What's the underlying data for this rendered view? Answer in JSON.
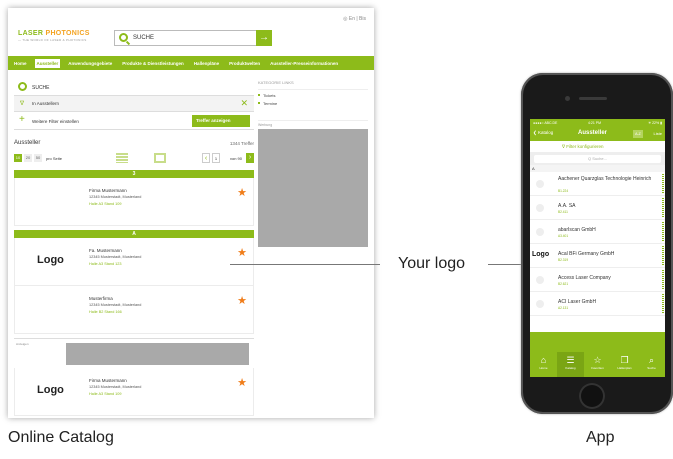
{
  "web": {
    "lang": "◎ En | Bis",
    "logo": "LASER",
    "logo_accent": "PHOTONICS",
    "logo_sub": "— THE WORLD OF LASER & PHOTONICS",
    "search_placeholder": "SUCHE",
    "search_go": "→",
    "nav": [
      "Home",
      "Aussteller",
      "Anwendungsgebiete",
      "Produkte & Dienstleistungen",
      "Hallenpläne",
      "Produktwelten",
      "Aussteller-Presseinformationen"
    ],
    "list_search": "SUCHE",
    "filter_label": "In Ausstellern",
    "more_filters": "Weitere Filter einstellen",
    "apply_button": "Treffer anzeigen",
    "results_title": "Aussteller",
    "results_count": "1344 Treffer",
    "page_sizes": [
      "10",
      "20",
      "50"
    ],
    "per_page": "pro Seite",
    "page_current": "1",
    "page_of": "von 90",
    "letter_1": "3",
    "letter_2": "A",
    "cards": [
      {
        "logo": "",
        "name": "Firma Mustermann",
        "address": "12345 Musterstadt, Musterland",
        "hall": "Halle A3 Stand 109"
      },
      {
        "logo": "Logo",
        "name": "Fa. Mustermann",
        "address": "12345 Musterstadt, Musterland",
        "hall": "Halle A3 Stand 123"
      },
      {
        "logo": "",
        "name": "Musterfirma",
        "address": "12345 Musterstadt, Musterland",
        "hall": "Halle B2 Stand 166"
      },
      {
        "logo": "Logo",
        "name": "Firma Mustermann",
        "address": "12345 Musterstadt, Musterland",
        "hall": "Halle A3 Stand 109"
      }
    ],
    "ad_label": "Anzeigen",
    "right_title": "KATEGORIE LINKS",
    "right_links": [
      "Tickets",
      "Termine"
    ],
    "right_ad_label": "Werbung"
  },
  "callout": {
    "label": "Your logo"
  },
  "captions": {
    "online": "Online Catalog",
    "app": "App"
  },
  "app": {
    "status_left": "●●●●○ ABC.DE",
    "status_time": "4:21 PM",
    "status_right": "✳ 22% ▮",
    "back": "❮ Katalog",
    "title": "Aussteller",
    "az": "A-Z",
    "list_label": "Liste",
    "filter": "∇  Filter konfigurieren",
    "search_placeholder": "Q  Suche...",
    "section": "A",
    "items": [
      {
        "logo": "",
        "name": "Aachener Quarzglas Technologie Heinrich",
        "hall": "B1.224"
      },
      {
        "logo": "",
        "name": "A.A. SA",
        "hall": "B2.411"
      },
      {
        "logo": "",
        "name": "abarIscan GmbH",
        "hall": "A3.401"
      },
      {
        "logo": "Logo",
        "name": "Acal BFi Germany GmbH",
        "hall": "B2.319"
      },
      {
        "logo": "",
        "name": "Access Laser Company",
        "hall": "B2.621"
      },
      {
        "logo": "",
        "name": "ACI Laser GmbH",
        "hall": "A2.131"
      }
    ],
    "tabs": [
      {
        "icon": "⌂",
        "label": "Home"
      },
      {
        "icon": "☰",
        "label": "Katalog"
      },
      {
        "icon": "☆",
        "label": "Favoriten"
      },
      {
        "icon": "❐",
        "label": "Hallenplan"
      },
      {
        "icon": "⌕",
        "label": "Suche"
      }
    ]
  }
}
